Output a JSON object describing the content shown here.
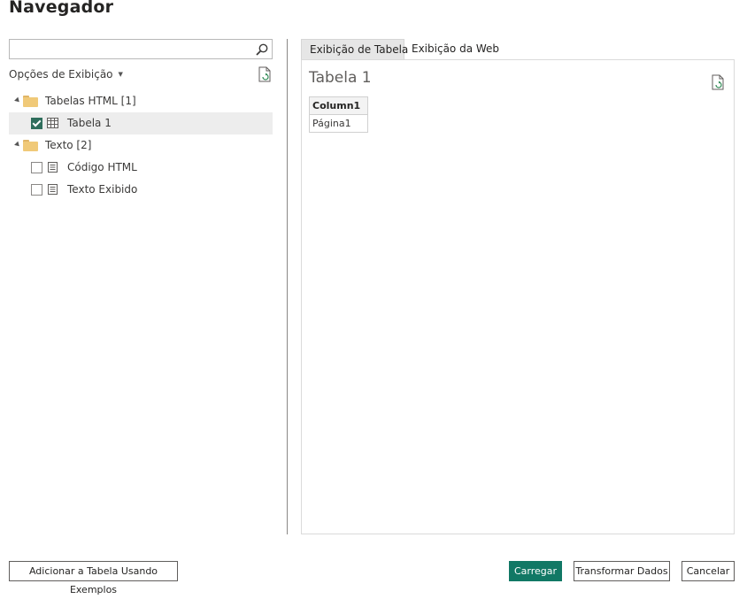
{
  "window": {
    "title": "Navegador"
  },
  "search": {
    "value": "",
    "placeholder": ""
  },
  "view_options": {
    "label": "Opções de Exibição"
  },
  "tree": [
    {
      "label": "Tabelas HTML [1]",
      "type": "folder",
      "expanded": true,
      "children": [
        {
          "label": "Tabela 1",
          "type": "table",
          "checked": true,
          "selected": true
        }
      ]
    },
    {
      "label": "Texto [2]",
      "type": "folder",
      "expanded": true,
      "children": [
        {
          "label": "Código HTML",
          "type": "document",
          "checked": false
        },
        {
          "label": "Texto Exibido",
          "type": "document",
          "checked": false
        }
      ]
    }
  ],
  "tabs": [
    {
      "label": "Exibição de Tabela",
      "active": true
    },
    {
      "label": "Exibição da Web",
      "active": false
    }
  ],
  "preview": {
    "title": "Tabela 1",
    "columns": [
      "Column1"
    ],
    "rows": [
      [
        "Página1"
      ]
    ]
  },
  "footer": {
    "add_table_label": "Adicionar a Tabela Usando Exemplos",
    "load_label": "Carregar",
    "transform_label": "Transformar Dados",
    "cancel_label": "Cancelar"
  },
  "colors": {
    "primary": "#117865",
    "checkbox": "#2f6e5c",
    "folder": "#f0c978"
  },
  "icons": [
    "search-icon",
    "refresh-icon",
    "folder-icon",
    "table-icon",
    "document-icon",
    "collapse-triangle-icon"
  ]
}
